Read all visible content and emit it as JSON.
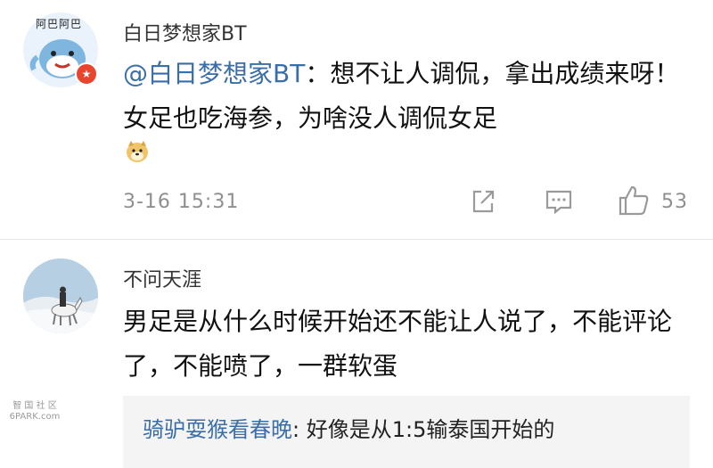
{
  "comments": [
    {
      "username": "白日梦想家BT",
      "avatar_text": "阿巴阿巴",
      "mention": "@白日梦想家BT",
      "text": "：想不让人调侃，拿出成绩来呀！女足也吃海参，为啥没人调侃女足",
      "time": "3-16 15:31",
      "like_count": "53"
    },
    {
      "username": "不问天涯",
      "text": "男足是从什么时候开始还不能让人说了，不能评论了，不能喷了，一群软蛋",
      "reply": {
        "user": "骑驴耍猴看春晚",
        "text": ": 好像是从1:5输泰国开始的"
      }
    }
  ],
  "watermark": {
    "line1": "智 国 社 区",
    "line2": "6PARK.com"
  },
  "colors": {
    "mention": "#3a6ea8",
    "meta": "#8f8f8f",
    "divider": "#e6e6e6",
    "reply_bg": "#f4f4f5",
    "badge": "#e8452f"
  },
  "icons": [
    "doge-emoji",
    "share-icon",
    "comment-icon",
    "like-icon",
    "verified-badge-icon"
  ]
}
